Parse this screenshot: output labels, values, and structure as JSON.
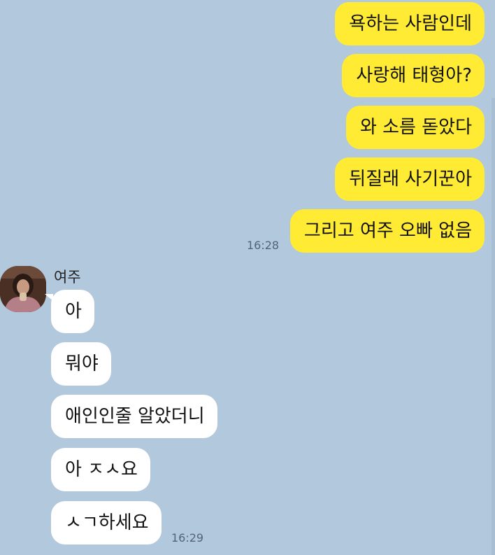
{
  "chat": {
    "outgoing": [
      {
        "text": "욕하는 사람인데"
      },
      {
        "text": "사랑해 태형아?"
      },
      {
        "text": "와 소름 돋았다"
      },
      {
        "text": "뒤질래 사기꾼아"
      },
      {
        "text": "그리고 여주 오빠 없음"
      }
    ],
    "outgoing_time": "16:28",
    "incoming_sender": {
      "name": "여주",
      "avatar_icon": "profile-photo"
    },
    "incoming": [
      {
        "text": "아"
      },
      {
        "text": "뭐야"
      },
      {
        "text": "애인인줄 알았더니"
      },
      {
        "text": "아 ㅈㅅ요"
      },
      {
        "text": "ㅅㄱ하세요"
      }
    ],
    "incoming_time": "16:29"
  },
  "colors": {
    "background": "#b2c8dc",
    "outgoing_bubble": "#ffeb33",
    "incoming_bubble": "#ffffff"
  }
}
